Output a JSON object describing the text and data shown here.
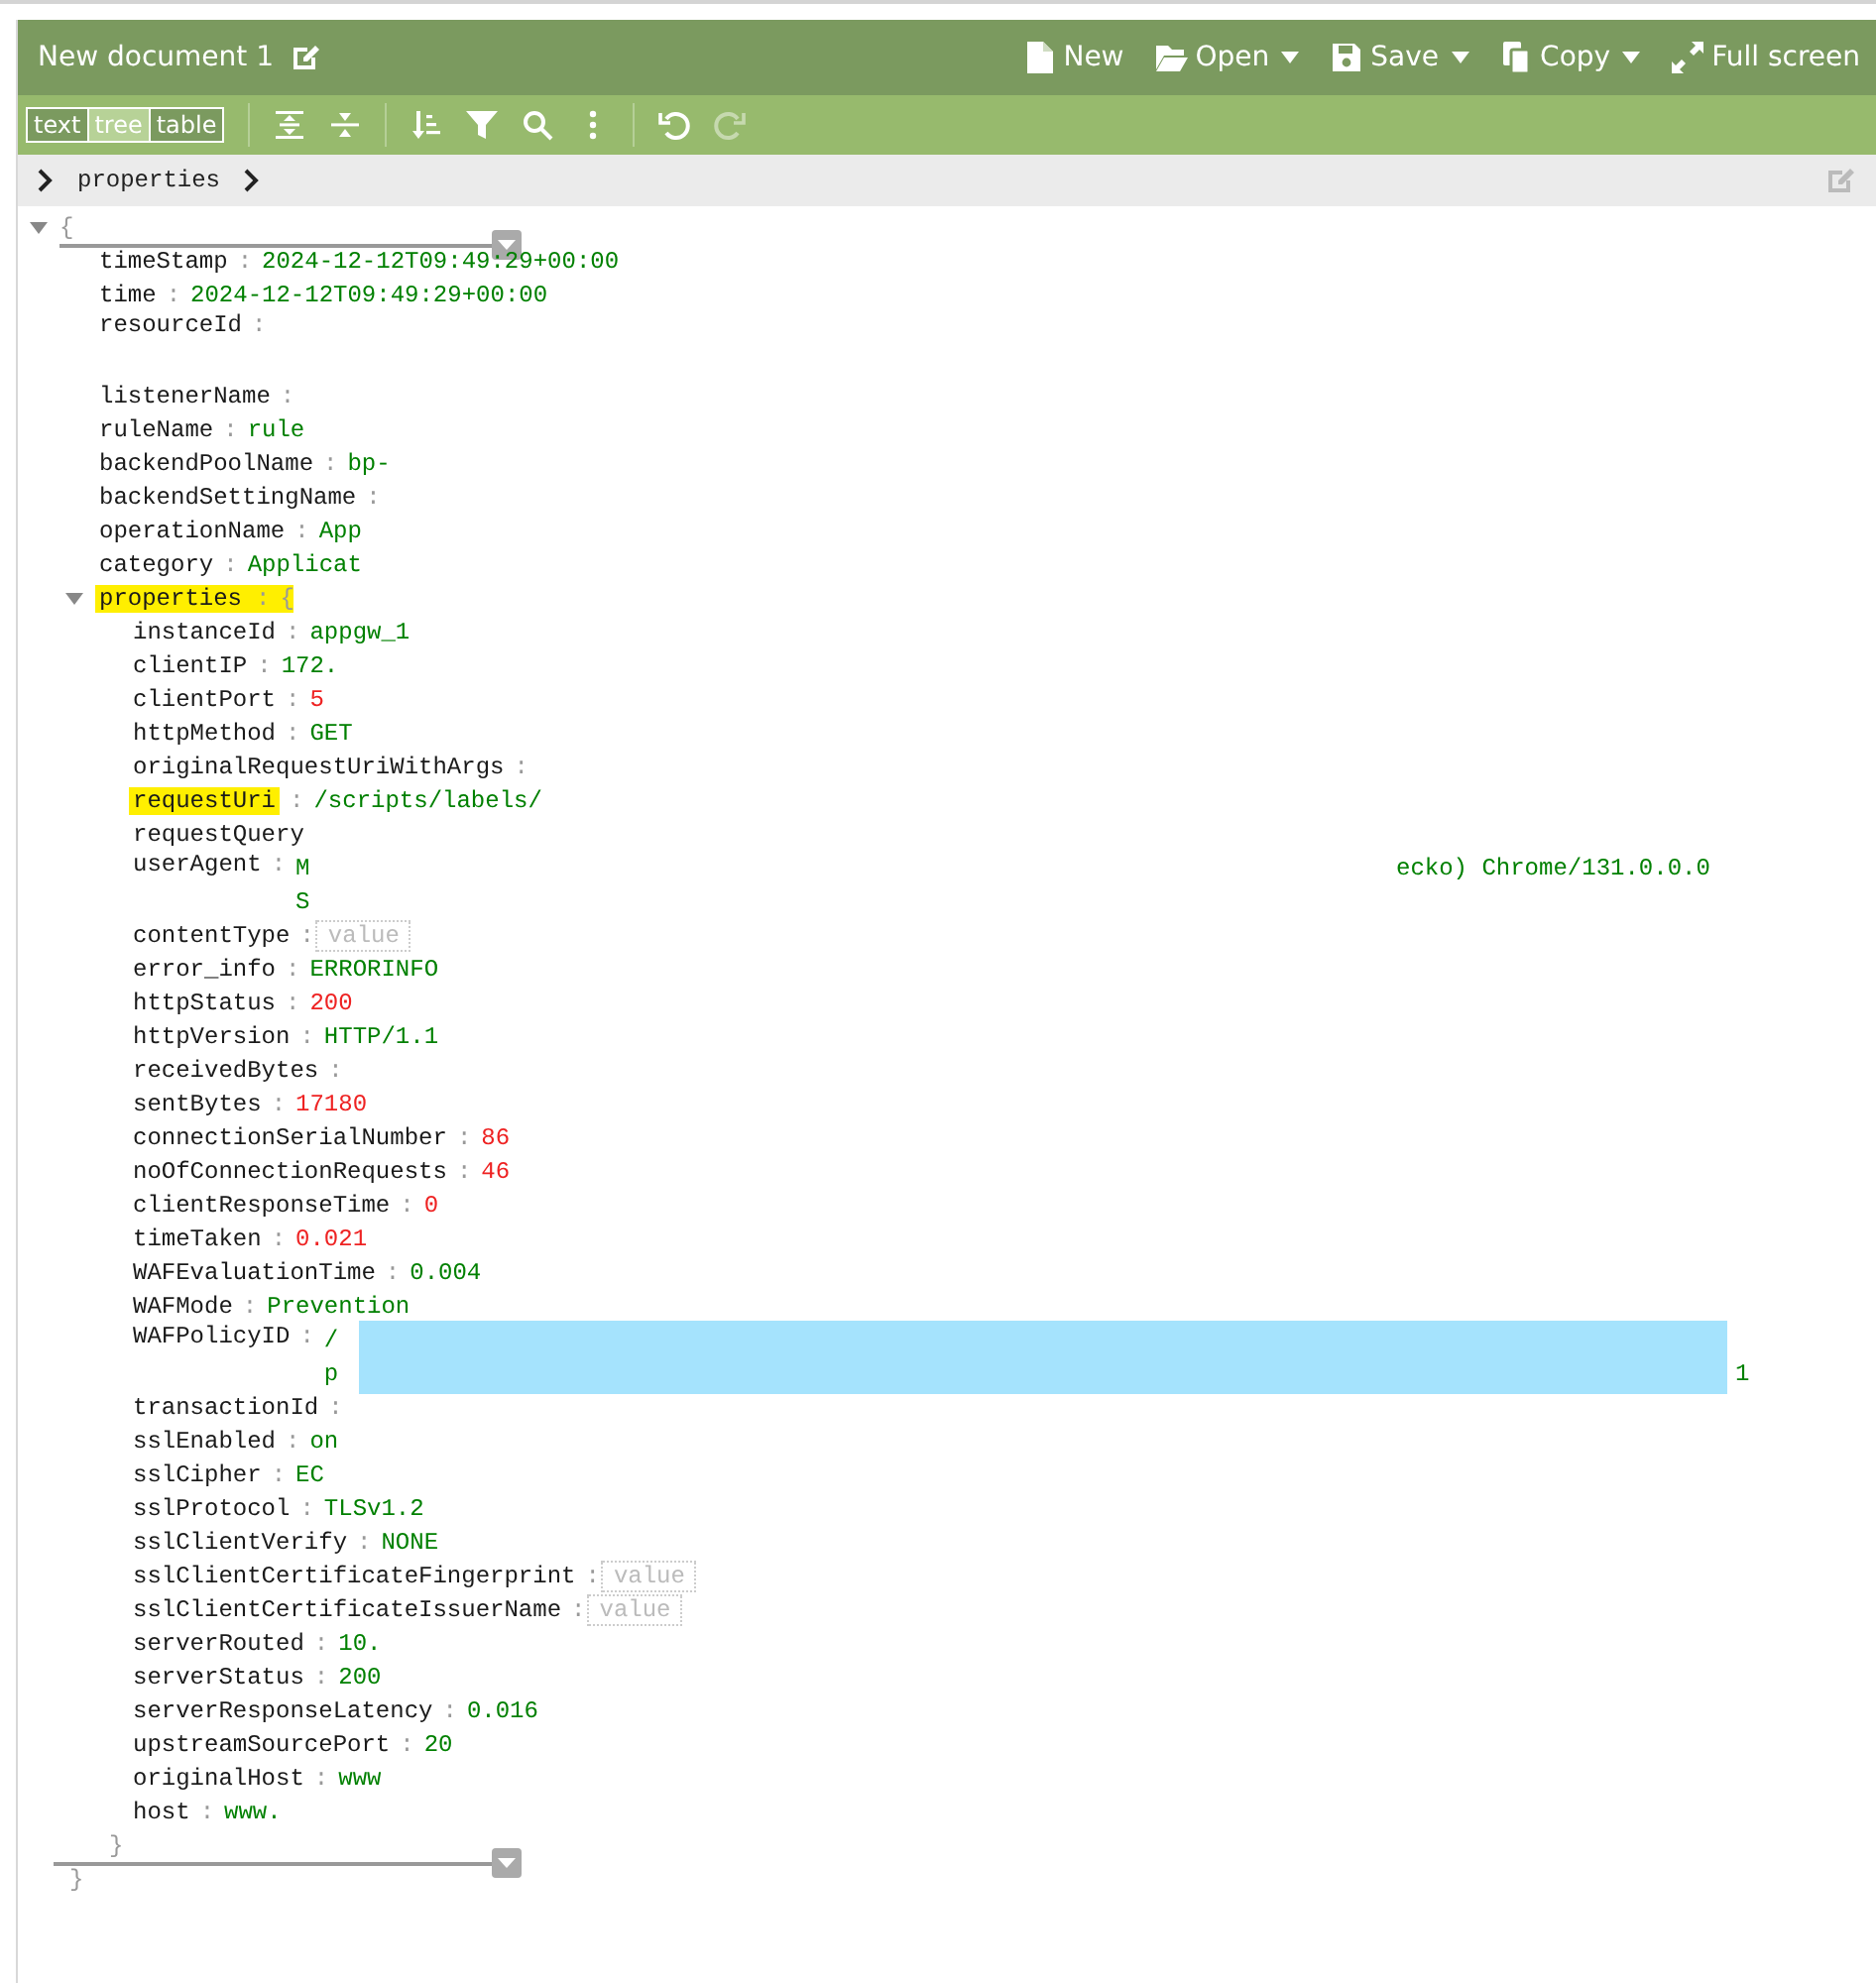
{
  "header": {
    "title": "New document 1",
    "actions": [
      {
        "label": "New",
        "dropdown": false
      },
      {
        "label": "Open",
        "dropdown": true
      },
      {
        "label": "Save",
        "dropdown": true
      },
      {
        "label": "Copy",
        "dropdown": true
      },
      {
        "label": "Full screen",
        "dropdown": false
      }
    ]
  },
  "toolbar": {
    "modes": [
      {
        "label": "text",
        "selected": false
      },
      {
        "label": "tree",
        "selected": true
      },
      {
        "label": "table",
        "selected": false
      }
    ],
    "buttons": [
      {
        "disabled": false
      },
      {
        "disabled": false
      },
      {
        "disabled": false
      },
      {
        "disabled": false
      },
      {
        "disabled": false
      },
      {
        "disabled": false
      },
      {
        "disabled": false
      },
      {
        "disabled": true
      }
    ]
  },
  "breadcrumb": {
    "items": [
      "properties"
    ]
  },
  "tree": {
    "open_brace": "{",
    "close_brace": "}",
    "expanded": true,
    "children": [
      {
        "key": "timeStamp",
        "sep": ":",
        "kind": "string",
        "value": "2024-12-12T09:49:29+00:00"
      },
      {
        "key": "time",
        "sep": ":",
        "kind": "string",
        "value": "2024-12-12T09:49:29+00:00"
      },
      {
        "key": "resourceId",
        "sep": ":",
        "kind": "wrapped"
      },
      {
        "key": "listenerName",
        "sep": ":",
        "kind": "blank"
      },
      {
        "key": "ruleName",
        "sep": ":",
        "kind": "string",
        "value": "rule"
      },
      {
        "key": "backendPoolName",
        "sep": ":",
        "kind": "string",
        "value": "bp-"
      },
      {
        "key": "backendSettingName",
        "sep": ":",
        "kind": "blank"
      },
      {
        "key": "operationName",
        "sep": ":",
        "kind": "string",
        "value": "App"
      },
      {
        "key": "category",
        "sep": ":",
        "kind": "string",
        "value": "Applicat"
      },
      {
        "key": "properties",
        "sep": ":",
        "kind": "object",
        "highlighted": true,
        "expanded": true,
        "open_brace": "{",
        "close_brace": "}",
        "children": [
          {
            "key": "instanceId",
            "sep": ":",
            "kind": "string",
            "value": "appgw_1"
          },
          {
            "key": "clientIP",
            "sep": ":",
            "kind": "string",
            "value": "172."
          },
          {
            "key": "clientPort",
            "sep": ":",
            "kind": "number",
            "value": "5"
          },
          {
            "key": "httpMethod",
            "sep": ":",
            "kind": "string",
            "value": "GET"
          },
          {
            "key": "originalRequestUriWithArgs",
            "sep": ":",
            "kind": "blank"
          },
          {
            "key": "requestUri",
            "sep": ":",
            "kind": "string",
            "value": "/scripts/labels/",
            "highlighted": true
          },
          {
            "key": "requestQuery",
            "kind": "blank"
          },
          {
            "key": "userAgent",
            "sep": ":",
            "kind": "string",
            "value": "M",
            "tail": "ecko) Chrome/131.0.0.0",
            "line2": "S"
          },
          {
            "key": "contentType",
            "sep": ":",
            "kind": "empty",
            "placeholder": "value"
          },
          {
            "key": "error_info",
            "sep": ":",
            "kind": "string",
            "value": "ERRORINFO"
          },
          {
            "key": "httpStatus",
            "sep": ":",
            "kind": "number",
            "value": "200"
          },
          {
            "key": "httpVersion",
            "sep": ":",
            "kind": "string",
            "value": "HTTP/1.1"
          },
          {
            "key": "receivedBytes",
            "sep": ":",
            "kind": "blank"
          },
          {
            "key": "sentBytes",
            "sep": ":",
            "kind": "number",
            "value": "17180"
          },
          {
            "key": "connectionSerialNumber",
            "sep": ":",
            "kind": "number",
            "value": "86"
          },
          {
            "key": "noOfConnectionRequests",
            "sep": ":",
            "kind": "number",
            "value": "46"
          },
          {
            "key": "clientResponseTime",
            "sep": ":",
            "kind": "number",
            "value": "0"
          },
          {
            "key": "timeTaken",
            "sep": ":",
            "kind": "number",
            "value": "0.021"
          },
          {
            "key": "WAFEvaluationTime",
            "sep": ":",
            "kind": "string",
            "value": "0.004"
          },
          {
            "key": "WAFMode",
            "sep": ":",
            "kind": "string",
            "value": "Prevention"
          },
          {
            "key": "WAFPolicyID",
            "sep": ":",
            "kind": "string",
            "value": "/",
            "line2": "p",
            "line2_tail": "1",
            "redacted": true
          },
          {
            "key": "transactionId",
            "sep": ":",
            "kind": "blank"
          },
          {
            "key": "sslEnabled",
            "sep": ":",
            "kind": "string",
            "value": "on"
          },
          {
            "key": "sslCipher",
            "sep": ":",
            "kind": "string",
            "value": "EC"
          },
          {
            "key": "sslProtocol",
            "sep": ":",
            "kind": "string",
            "value": "TLSv1.2"
          },
          {
            "key": "sslClientVerify",
            "sep": ":",
            "kind": "string",
            "value": "NONE"
          },
          {
            "key": "sslClientCertificateFingerprint",
            "sep": ":",
            "kind": "empty",
            "placeholder": "value"
          },
          {
            "key": "sslClientCertificateIssuerName",
            "sep": ":",
            "kind": "empty",
            "placeholder": "value"
          },
          {
            "key": "serverRouted",
            "sep": ":",
            "kind": "string",
            "value": "10."
          },
          {
            "key": "serverStatus",
            "sep": ":",
            "kind": "string",
            "value": "200"
          },
          {
            "key": "serverResponseLatency",
            "sep": ":",
            "kind": "string",
            "value": "0.016"
          },
          {
            "key": "upstreamSourcePort",
            "sep": ":",
            "kind": "string",
            "value": "20"
          },
          {
            "key": "originalHost",
            "sep": ":",
            "kind": "string",
            "value": "www"
          },
          {
            "key": "host",
            "sep": ":",
            "kind": "string",
            "value": "www."
          }
        ]
      }
    ]
  }
}
